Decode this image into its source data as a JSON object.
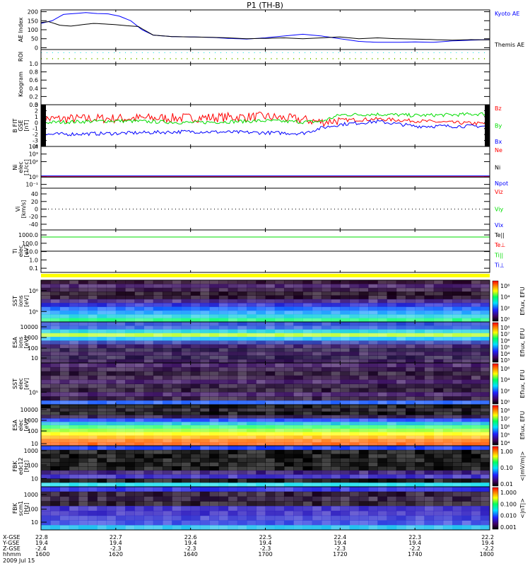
{
  "chart_data": {
    "type": "line",
    "title": "P1 (TH-B)",
    "date": "2009 Jul 15",
    "time_axis": {
      "label": "hhmm",
      "ticks": [
        "1600",
        "1620",
        "1640",
        "1700",
        "1720",
        "1740",
        "1800"
      ],
      "range_minutes": [
        0,
        120
      ],
      "ephemeris": [
        {
          "label": "X-GSE",
          "values": [
            "22.8",
            "22.7",
            "22.6",
            "22.5",
            "22.4",
            "22.3",
            "22.2"
          ]
        },
        {
          "label": "Y-GSE",
          "values": [
            "19.4",
            "19.4",
            "19.4",
            "19.4",
            "19.4",
            "19.4",
            "19.4"
          ]
        },
        {
          "label": "Z-GSE",
          "values": [
            "-2.4",
            "-2.3",
            "-2.3",
            "-2.3",
            "-2.3",
            "-2.2",
            "-2.2"
          ]
        }
      ]
    },
    "panels": [
      {
        "id": "ae",
        "ylabel": [
          "AE Index"
        ],
        "type": "line",
        "ylim": [
          -10,
          210
        ],
        "yticks": [
          "200",
          "150",
          "100",
          "50",
          "0"
        ],
        "ytick_values": [
          200,
          150,
          100,
          50,
          0
        ],
        "legend": [
          {
            "label": "Kyoto AE",
            "color": "#0000ff"
          },
          {
            "label": "Themis AE",
            "color": "#000000"
          }
        ],
        "series": [
          {
            "name": "Kyoto AE",
            "color": "#0000ff",
            "x": [
              0,
              3,
              6,
              9,
              12,
              15,
              18,
              21,
              24,
              27,
              30,
              35,
              40,
              45,
              50,
              55,
              60,
              65,
              70,
              75,
              80,
              85,
              90,
              95,
              100,
              105,
              110,
              115,
              120
            ],
            "y": [
              135,
              150,
              185,
              190,
              195,
              190,
              188,
              175,
              150,
              100,
              70,
              62,
              60,
              58,
              52,
              48,
              55,
              65,
              75,
              65,
              50,
              35,
              30,
              30,
              32,
              30,
              38,
              42,
              45
            ]
          },
          {
            "name": "Themis AE",
            "color": "#000000",
            "x": [
              0,
              2,
              5,
              8,
              11,
              14,
              17,
              20,
              23,
              26,
              30,
              35,
              40,
              45,
              50,
              55,
              60,
              65,
              70,
              75,
              80,
              85,
              90,
              95,
              100,
              105,
              110,
              115,
              120
            ],
            "y": [
              140,
              145,
              125,
              120,
              128,
              135,
              132,
              128,
              122,
              118,
              70,
              62,
              60,
              58,
              55,
              50,
              52,
              55,
              50,
              55,
              60,
              50,
              55,
              50,
              48,
              45,
              42,
              45,
              44
            ]
          }
        ]
      },
      {
        "id": "roi",
        "ylabel": [
          "ROI"
        ],
        "type": "dots",
        "yticks": []
      },
      {
        "id": "keogram",
        "ylabel": [
          "Keogram"
        ],
        "type": "empty",
        "ylim": [
          0,
          1
        ],
        "yticks": [
          "1.0",
          "0.8",
          "0.6",
          "0.4",
          "0.2",
          "0.0"
        ],
        "ytick_values": [
          1,
          0.8,
          0.6,
          0.4,
          0.2,
          0
        ]
      },
      {
        "id": "bfit",
        "ylabel": [
          "B FIT",
          "GSE",
          "[nT]"
        ],
        "type": "line",
        "ylim": [
          -4,
          3
        ],
        "yticks": [
          "3",
          "2",
          "1",
          "0",
          "-1",
          "-2",
          "-3",
          "-4"
        ],
        "ytick_values": [
          3,
          2,
          1,
          0,
          -1,
          -2,
          -3,
          -4
        ],
        "legend": [
          {
            "label": "Bz",
            "color": "#ff0000"
          },
          {
            "label": "By",
            "color": "#00dd00"
          },
          {
            "label": "Bx",
            "color": "#0000ff"
          }
        ],
        "series": [
          {
            "name": "Bz",
            "color": "#ff0000",
            "x": [
              0,
              20,
              40,
              60,
              70,
              75,
              80,
              90,
              100,
              110,
              120
            ],
            "y": [
              0.6,
              0.7,
              0.8,
              1.0,
              0.5,
              0.1,
              0.4,
              0.6,
              0.3,
              0.0,
              -0.2
            ]
          },
          {
            "name": "By",
            "color": "#00dd00",
            "x": [
              0,
              20,
              40,
              60,
              70,
              75,
              80,
              90,
              100,
              110,
              120
            ],
            "y": [
              0.0,
              0.3,
              0.0,
              0.3,
              0.1,
              0.2,
              1.3,
              1.4,
              1.2,
              1.3,
              1.5
            ]
          },
          {
            "name": "Bx",
            "color": "#0000ff",
            "x": [
              0,
              20,
              40,
              60,
              70,
              75,
              80,
              90,
              100,
              110,
              120
            ],
            "y": [
              -2.0,
              -1.8,
              -1.5,
              -1.7,
              -1.8,
              -0.9,
              -0.3,
              0.2,
              -0.6,
              -0.6,
              -0.6
            ]
          }
        ]
      },
      {
        "id": "ni",
        "ylabel": [
          "Ni",
          "elec",
          "[1/cc]"
        ],
        "type": "line",
        "ylim": [
          -1.5,
          4
        ],
        "yticks": [
          "10⁴",
          "10³",
          "10²",
          "10⁰",
          "10⁻¹"
        ],
        "ytick_values": [
          4,
          3,
          2,
          0,
          -1
        ],
        "legend": [
          {
            "label": "Ne",
            "color": "#ff0000"
          },
          {
            "label": "Ni",
            "color": "#000000"
          },
          {
            "label": "Npot",
            "color": "#0000ff"
          }
        ],
        "series": [
          {
            "name": "Ne",
            "color": "#ff0000",
            "x": [
              0,
              120
            ],
            "y": [
              0.05,
              0.05
            ]
          },
          {
            "name": "Ni",
            "color": "#000000",
            "x": [
              0,
              120
            ],
            "y": [
              -0.05,
              -0.05
            ]
          },
          {
            "name": "Npot",
            "color": "#0000ff",
            "x": [
              0,
              120
            ],
            "y": [
              0.12,
              0.12
            ]
          }
        ]
      },
      {
        "id": "vi",
        "ylabel": [
          "Vi",
          "[km/s]"
        ],
        "type": "zero",
        "ylim": [
          -55,
          55
        ],
        "yticks": [
          "40",
          "20",
          "0",
          "-20",
          "-40"
        ],
        "ytick_values": [
          40,
          20,
          0,
          -20,
          -40
        ],
        "legend": [
          {
            "label": "Viz",
            "color": "#ff0000"
          },
          {
            "label": "Viy",
            "color": "#00dd00"
          },
          {
            "label": "Vix",
            "color": "#0000ff"
          }
        ]
      },
      {
        "id": "ti",
        "ylabel": [
          "Ti",
          "elec",
          "[eV]"
        ],
        "type": "line",
        "ylim": [
          -1.5,
          3.6
        ],
        "yticks": [
          "1000.0",
          "100.0",
          "10.0",
          "1.0",
          "0.1"
        ],
        "ytick_values": [
          3,
          2,
          1,
          0,
          -1
        ],
        "legend": [
          {
            "label": "Te||",
            "color": "#000000"
          },
          {
            "label": "Te⊥",
            "color": "#ff0000"
          },
          {
            "label": "Ti||",
            "color": "#00dd00"
          },
          {
            "label": "Ti⊥",
            "color": "#0000ff"
          }
        ],
        "series": [
          {
            "name": "Ti||",
            "color": "#00dd00",
            "x": [
              0,
              120
            ],
            "y": [
              2.75,
              2.75
            ]
          },
          {
            "name": "Te||",
            "color": "#000000",
            "x": [
              0,
              120
            ],
            "y": [
              1.05,
              1.05
            ]
          }
        ]
      },
      {
        "id": "sst_ion",
        "ylabel": [
          "SST",
          "ions",
          "[eV]"
        ],
        "type": "spec",
        "yticks": [
          "10⁶",
          "10⁵"
        ],
        "ytick_frac": [
          0.25,
          0.75
        ],
        "colorbar": {
          "ticks": [
            "10⁶",
            "10⁴",
            "10²",
            "10⁰"
          ],
          "label": "Eflux, EFU"
        },
        "rows": [
          "#220022",
          "#3a1060",
          "#2a0a3a",
          "#150015",
          "#1a0020",
          "#3b1a80",
          "#2020d0",
          "#1060ff",
          "#20a0ff",
          "#20d0e0",
          "#20ff80"
        ]
      },
      {
        "id": "esa_ion",
        "ylabel": [
          "ESA",
          "ions",
          "[eV]"
        ],
        "type": "spec",
        "yticks": [
          "10000",
          "1000",
          "100",
          "10"
        ],
        "ytick_frac": [
          0.12,
          0.38,
          0.64,
          0.88
        ],
        "colorbar": {
          "ticks": [
            "10⁸",
            "10⁷",
            "10⁶",
            "10⁵",
            "10⁴",
            "10³"
          ],
          "label": "Eflux, EFU"
        },
        "rows": [
          "#2040d0",
          "#3060e0",
          "#20d0e0",
          "#c0ff40",
          "#20c0ff",
          "#3040b0",
          "#301060",
          "#201040",
          "#301050",
          "#201040",
          "#2a0a4a"
        ]
      },
      {
        "id": "sst_elec",
        "ylabel": [
          "SST",
          "elec",
          "[eV]"
        ],
        "type": "spec",
        "yticks": [
          "10⁵"
        ],
        "ytick_frac": [
          0.7
        ],
        "colorbar": {
          "ticks": [
            "10⁶",
            "10⁴",
            "10²",
            "10⁰"
          ],
          "label": "Eflux, EFU"
        },
        "rows": [
          "#3a1060",
          "#2a0a40",
          "#1a0525",
          "#2a0a3a",
          "#3a1060",
          "#200830",
          "#1a0525",
          "#3a1060",
          "#200830",
          "#2060ff"
        ]
      },
      {
        "id": "esa_elec",
        "ylabel": [
          "ESA",
          "elec",
          "[eV]"
        ],
        "type": "spec",
        "yticks": [
          "10000",
          "1000",
          "100",
          "10"
        ],
        "ytick_frac": [
          0.12,
          0.38,
          0.64,
          0.95
        ],
        "colorbar": {
          "ticks": [
            "10⁸",
            "10⁷",
            "10⁶",
            "10⁵",
            "10⁴"
          ],
          "label": "Eflux, EFU"
        },
        "rows": [
          "#000000",
          "#0a0010",
          "#000000",
          "#200840",
          "#2040ff",
          "#20c0e0",
          "#40ff80",
          "#a0ff40",
          "#ffff20",
          "#ffc020",
          "#ff8020",
          "#ff6010"
        ]
      },
      {
        "id": "fbk_edc12",
        "ylabel": [
          "FBK",
          "edc12",
          "[Hz]"
        ],
        "type": "spec",
        "yticks": [
          "1000",
          "100",
          "10"
        ],
        "ytick_frac": [
          0.12,
          0.47,
          0.8
        ],
        "colorbar": {
          "ticks": [
            "1.00",
            "0.10",
            "0.01"
          ],
          "label": "<|mV/m|>"
        },
        "rows": [
          "#1030ff",
          "#000000",
          "#000000",
          "#000000",
          "#000000",
          "#000000",
          "#2a0a6a",
          "#3020c0",
          "#000000",
          "#20e0f0"
        ]
      },
      {
        "id": "fbk_scm1",
        "ylabel": [
          "FBK",
          "scm1",
          "[Hz]"
        ],
        "type": "spec",
        "yticks": [
          "1000",
          "100",
          "10"
        ],
        "ytick_frac": [
          0.18,
          0.52,
          0.82
        ],
        "colorbar": {
          "ticks": [
            "1.000",
            "0.100",
            "0.010",
            "0.001"
          ],
          "label": "<|nT|>"
        },
        "rows": [
          "#2020e0",
          "#1a0520",
          "#200a30",
          "#150515",
          "#3020c0",
          "#3020c0",
          "#3030d0",
          "#3040e0",
          "#20c0f0"
        ]
      }
    ]
  }
}
